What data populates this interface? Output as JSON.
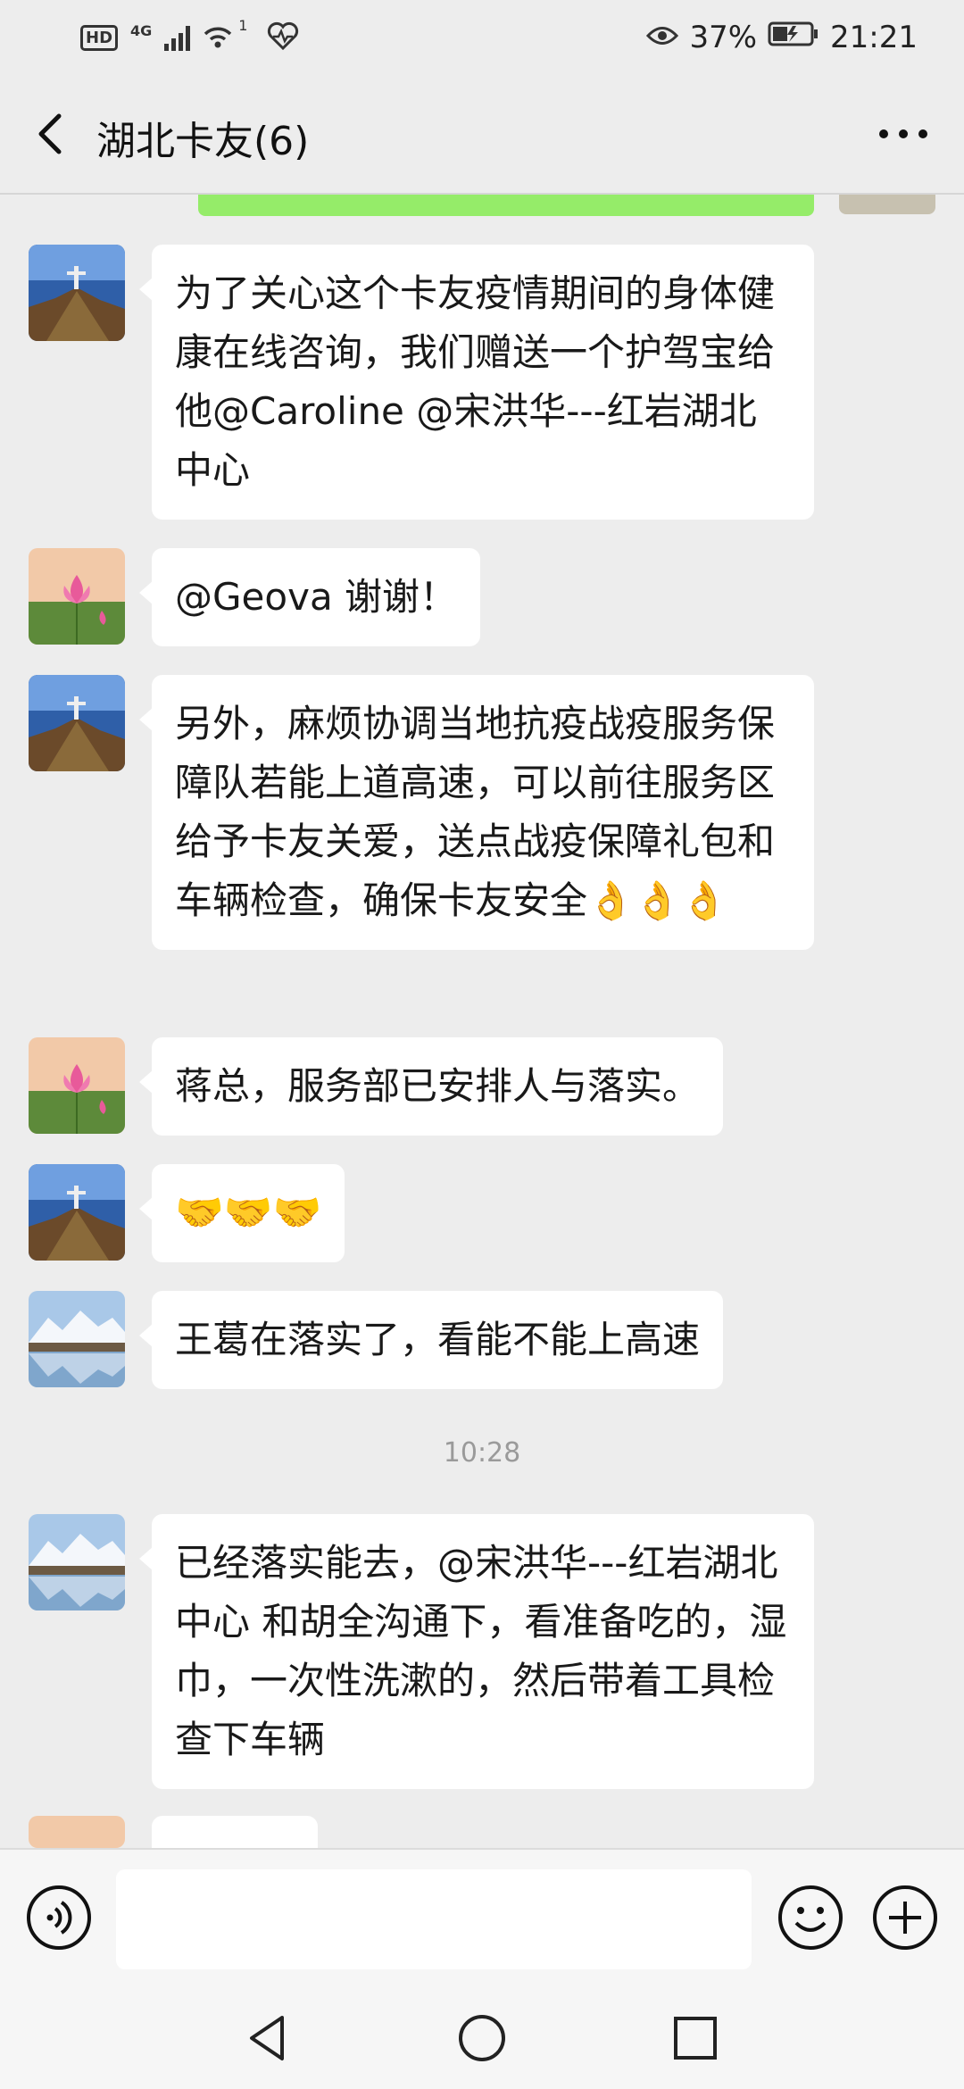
{
  "status_bar": {
    "network": "HD",
    "network_gen": "4G",
    "wifi_badge": "1",
    "battery": "37%",
    "time": "21:21"
  },
  "header": {
    "title": "湖北卡友(6)"
  },
  "messages": [
    {
      "avatar": "statue-avatar",
      "text": "为了关心这个卡友疫情期间的身体健康在线咨询，我们赠送一个护驾宝给他@Caroline @宋洪华---红岩湖北中心"
    },
    {
      "avatar": "lotus-avatar",
      "text": "@Geova  谢谢！"
    },
    {
      "avatar": "statue-avatar",
      "text": "另外，麻烦协调当地抗疫战疫服务保障队若能上道高速，可以前往服务区给予卡友关爱，送点战疫保障礼包和车辆检查，确保卡友安全👌👌👌"
    },
    {
      "avatar": "lotus-avatar",
      "text": "蒋总，服务部已安排人与落实。"
    },
    {
      "avatar": "statue-avatar",
      "text": "🤝🤝🤝"
    },
    {
      "avatar": "mountain-avatar",
      "text": "王葛在落实了，看能不能上高速"
    },
    {
      "avatar": "mountain-avatar",
      "text": "已经落实能去，@宋洪华---红岩湖北中心  和胡全沟通下，看准备吃的，湿巾，一次性洗漱的，然后带着工具检查下车辆"
    }
  ],
  "timestamp": "10:28",
  "icons": {
    "back": "back-arrow-icon",
    "more": "more-dots-icon",
    "voice": "voice-icon",
    "emoji": "emoji-icon",
    "add": "plus-icon"
  },
  "colors": {
    "background": "#ededed",
    "bubble": "#ffffff",
    "own_bubble": "#95ec69"
  }
}
